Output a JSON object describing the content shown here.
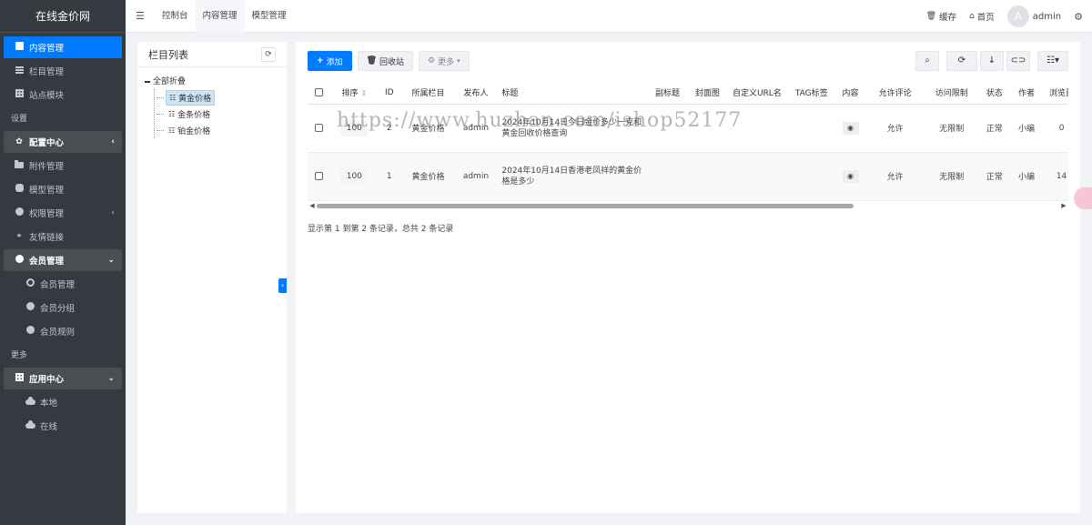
{
  "brand": "在线金价网",
  "sidebar": {
    "top_items": [
      {
        "label": "内容管理",
        "icon": "doc-icon"
      },
      {
        "label": "栏目管理",
        "icon": "list-icon"
      },
      {
        "label": "站点模块",
        "icon": "modules-icon"
      }
    ],
    "section_settings": "设置",
    "settings_items": [
      {
        "label": "配置中心",
        "icon": "gear-icon"
      },
      {
        "label": "附件管理",
        "icon": "folder-icon"
      },
      {
        "label": "模型管理",
        "icon": "database-icon"
      },
      {
        "label": "权限管理",
        "icon": "user-icon"
      },
      {
        "label": "友情链接",
        "icon": "link-icon"
      },
      {
        "label": "会员管理",
        "icon": "user-icon"
      }
    ],
    "member_sub": [
      {
        "label": "会员管理"
      },
      {
        "label": "会员分组"
      },
      {
        "label": "会员规则"
      }
    ],
    "section_more": "更多",
    "app_center": "应用中心",
    "app_sub": [
      {
        "label": "本地"
      },
      {
        "label": "在线"
      }
    ]
  },
  "topbar": {
    "tabs": [
      "控制台",
      "内容管理",
      "模型管理"
    ],
    "cache": "缓存",
    "home": "首页",
    "avatar_letter": "A",
    "admin": "admin"
  },
  "tree": {
    "title": "栏目列表",
    "root": "全部折叠",
    "nodes": [
      "黄金价格",
      "金条价格",
      "铂金价格"
    ]
  },
  "toolbar": {
    "add": "添加",
    "recycle": "回收站",
    "more": "更多"
  },
  "table": {
    "headers": [
      "排序",
      "ID",
      "所属栏目",
      "发布人",
      "标题",
      "副标题",
      "封面图",
      "自定义URL名",
      "TAG标签",
      "内容",
      "允许评论",
      "访问限制",
      "状态",
      "作者",
      "浏览量"
    ],
    "rows": [
      {
        "order": "100",
        "id": "2",
        "column": "黄金价格",
        "publisher": "admin",
        "title": "2024年10月14日今日金价多少一克和黄金回收价格查询",
        "comment": "允许",
        "access": "无限制",
        "status": "正常",
        "author": "小编",
        "views": "0"
      },
      {
        "order": "100",
        "id": "1",
        "column": "黄金价格",
        "publisher": "admin",
        "title": "2024年10月14日香港老凤祥的黄金价格是多少",
        "comment": "允许",
        "access": "无限制",
        "status": "正常",
        "author": "小编",
        "views": "14"
      }
    ]
  },
  "record_info": "显示第 1 到第 2 条记录，总共 2 条记录",
  "watermark": "https://www.huzhan.com/ishop52177",
  "colors": {
    "primary": "#007bff",
    "sidebar": "#343a40"
  }
}
